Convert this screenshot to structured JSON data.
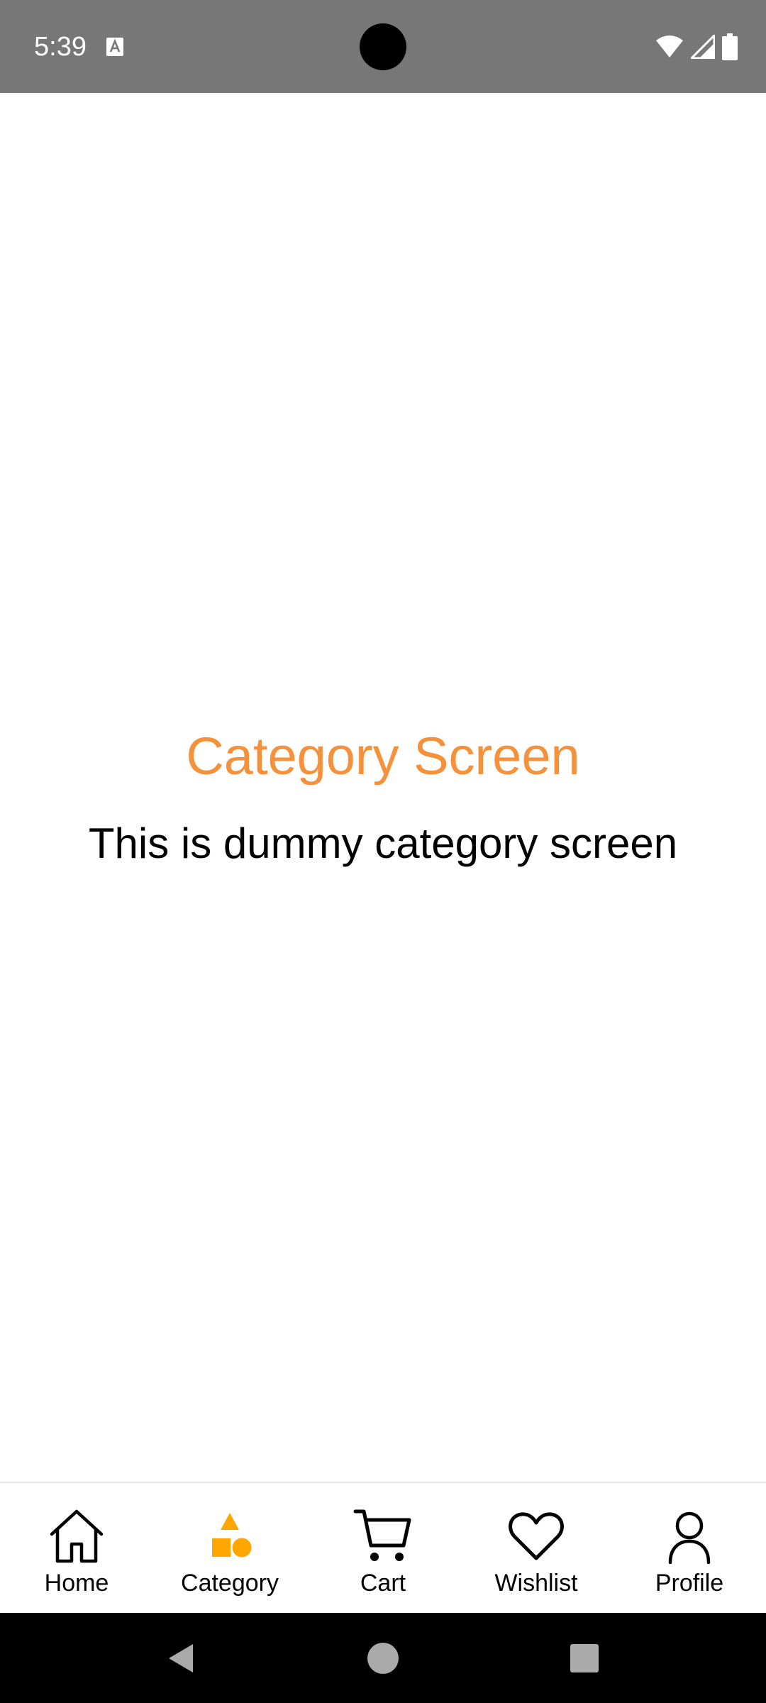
{
  "status_bar": {
    "time": "5:39",
    "icons": [
      "notification-a-icon",
      "wifi-icon",
      "cellular-icon",
      "battery-icon"
    ]
  },
  "main": {
    "title": "Category Screen",
    "subtitle": "This is dummy category screen"
  },
  "colors": {
    "accent": "#f4913a",
    "active_icon": "#ffa500",
    "status_bar_bg": "#777777",
    "system_nav_bg": "#000000"
  },
  "bottom_nav": {
    "items": [
      {
        "label": "Home",
        "icon": "home-icon",
        "active": false
      },
      {
        "label": "Category",
        "icon": "category-shapes-icon",
        "active": true
      },
      {
        "label": "Cart",
        "icon": "cart-icon",
        "active": false
      },
      {
        "label": "Wishlist",
        "icon": "heart-icon",
        "active": false
      },
      {
        "label": "Profile",
        "icon": "profile-icon",
        "active": false
      }
    ]
  },
  "system_nav": {
    "buttons": [
      "back-icon",
      "home-circle-icon",
      "recents-icon"
    ]
  }
}
